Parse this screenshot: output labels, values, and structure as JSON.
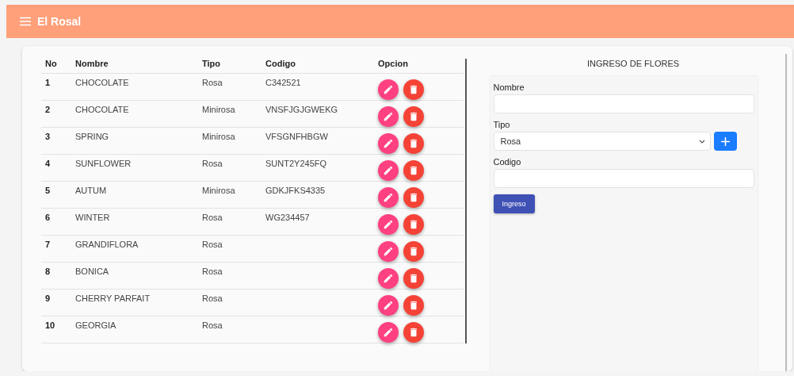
{
  "app_bar": {
    "title": "El Rosal"
  },
  "table": {
    "columns": [
      "No",
      "Nombre",
      "Tipo",
      "Codigo",
      "Opcion"
    ],
    "rows": [
      {
        "no": "1",
        "nombre": "CHOCOLATE",
        "tipo": "Rosa",
        "codigo": "C342521"
      },
      {
        "no": "2",
        "nombre": "CHOCOLATE",
        "tipo": "Minirosa",
        "codigo": "VNSFJGJGWEKG"
      },
      {
        "no": "3",
        "nombre": "SPRING",
        "tipo": "Minirosa",
        "codigo": "VFSGNFHBGW"
      },
      {
        "no": "4",
        "nombre": "SUNFLOWER",
        "tipo": "Rosa",
        "codigo": "SUNT2Y245FQ"
      },
      {
        "no": "5",
        "nombre": "AUTUM",
        "tipo": "Minirosa",
        "codigo": "GDKJFKS4335"
      },
      {
        "no": "6",
        "nombre": "WINTER",
        "tipo": "Rosa",
        "codigo": "WG234457"
      },
      {
        "no": "7",
        "nombre": "GRANDIFLORA",
        "tipo": "Rosa"
      },
      {
        "no": "8",
        "nombre": "BONICA",
        "tipo": "Rosa"
      },
      {
        "no": "9",
        "nombre": "CHERRY PARFAIT",
        "tipo": "Rosa"
      },
      {
        "no": "10",
        "nombre": "GEORGIA",
        "tipo": "Rosa"
      }
    ]
  },
  "form": {
    "title": "INGRESO DE FLORES",
    "fields": [
      {
        "kind": "text",
        "label": "Nombre"
      },
      {
        "kind": "select",
        "label": "Tipo",
        "value": "Rosa"
      },
      {
        "kind": "text",
        "label": "Codigo"
      }
    ],
    "submit": "Ingreso"
  }
}
